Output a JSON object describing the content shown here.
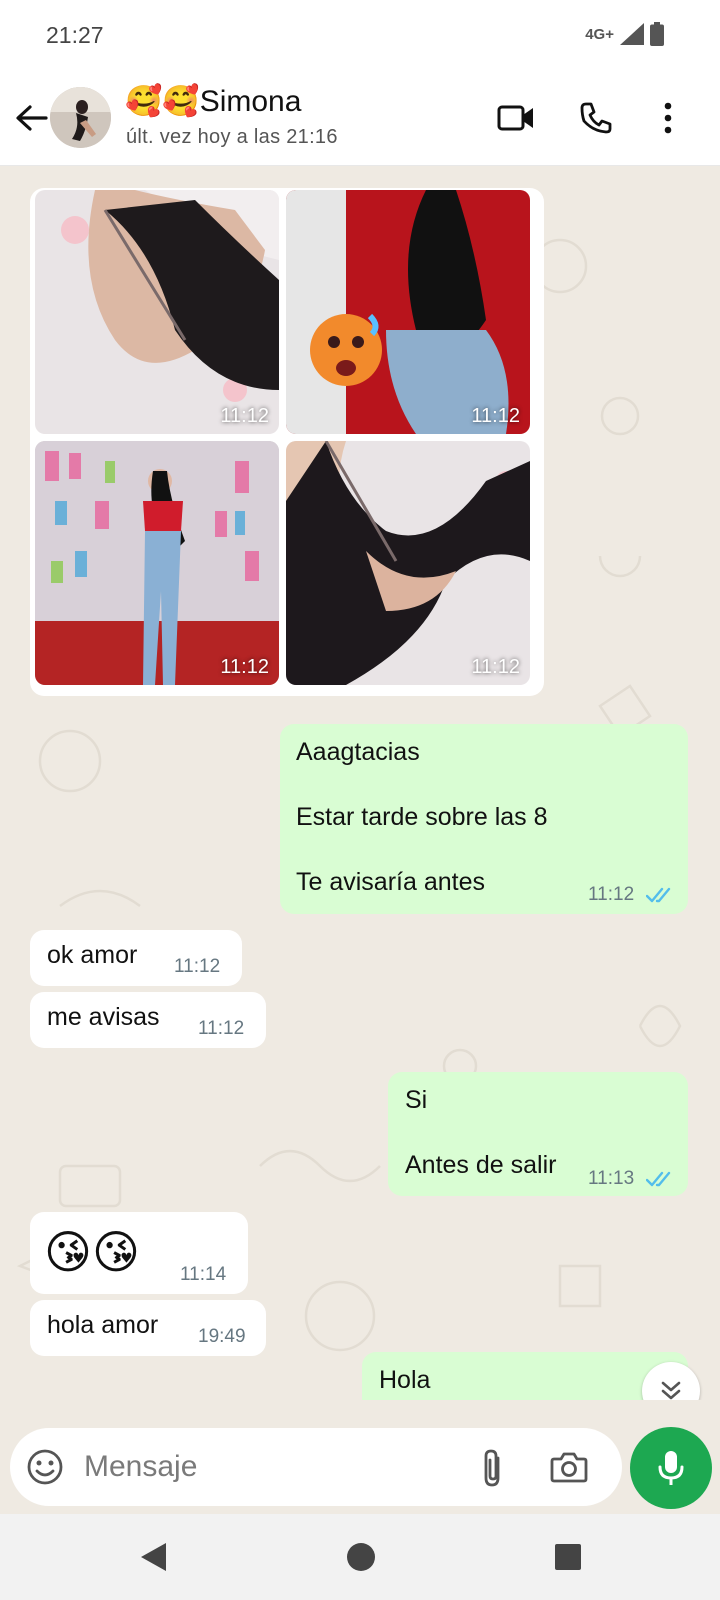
{
  "status_bar": {
    "time": "21:27",
    "network": "4G+"
  },
  "header": {
    "name": "🥰🥰Simona",
    "last_seen": "últ. vez hoy a las 21:16"
  },
  "album": {
    "photos": [
      {
        "time": "11:12"
      },
      {
        "time": "11:12"
      },
      {
        "time": "11:12"
      },
      {
        "time": "11:12"
      }
    ]
  },
  "messages": [
    {
      "direction": "out",
      "lines": [
        "Aaagtacias",
        "Estar tarde sobre las 8",
        "Te avisaría antes"
      ],
      "time": "11:12",
      "status": "read"
    },
    {
      "direction": "in",
      "text": "ok amor",
      "time": "11:12"
    },
    {
      "direction": "in",
      "text": "me avisas",
      "time": "11:12"
    },
    {
      "direction": "out",
      "lines": [
        "Si",
        "Antes de salir"
      ],
      "time": "11:13",
      "status": "read"
    },
    {
      "direction": "in",
      "text": "😘😘",
      "time": "11:14"
    },
    {
      "direction": "in",
      "text": "hola amor",
      "time": "19:49"
    },
    {
      "direction": "out",
      "text": "Hola"
    }
  ],
  "composer": {
    "placeholder": "Mensaje"
  },
  "colors": {
    "accent": "#1da851",
    "outgoing_bubble": "#d9fdd3",
    "incoming_bubble": "#ffffff",
    "chat_background": "#efeae2",
    "read_ticks": "#53bdeb"
  }
}
